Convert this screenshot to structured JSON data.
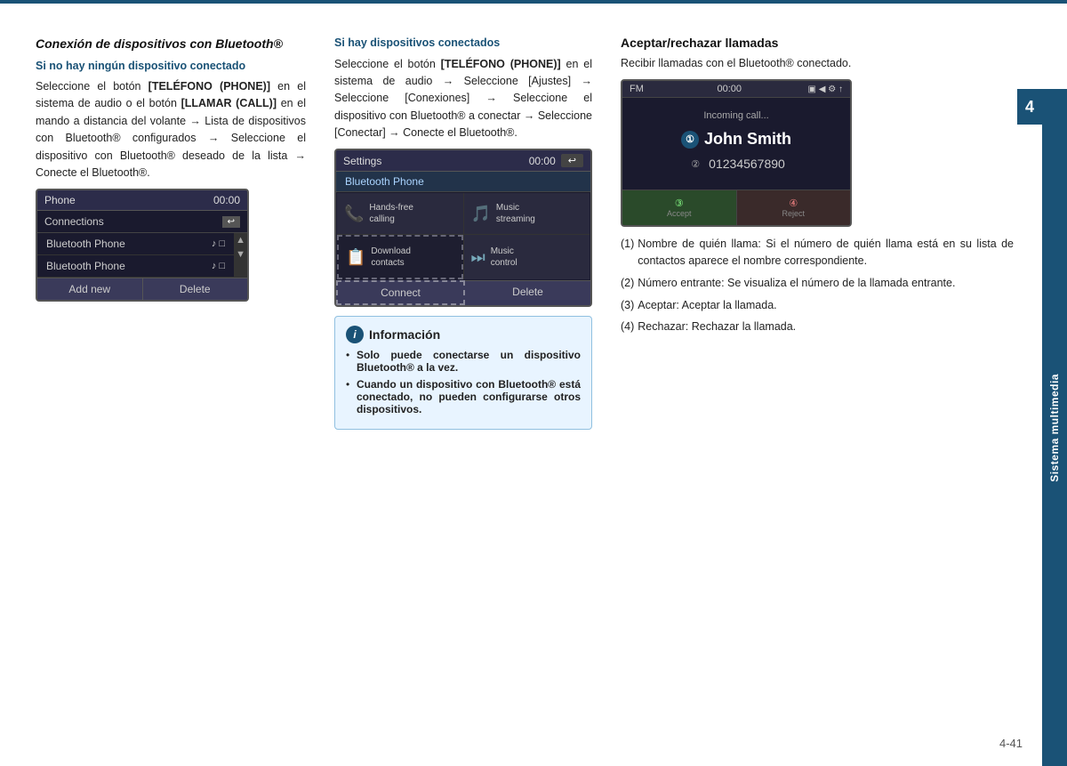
{
  "topLine": {
    "color": "#1a5276"
  },
  "sidebar": {
    "label": "Sistema multimedia",
    "pageNum": "4",
    "color": "#1a5276"
  },
  "pageNumber": "4-41",
  "leftCol": {
    "sectionTitle": "Conexión de dispositivos con Bluetooth®",
    "subtitle1": "Si no hay ningún dispositivo conectado",
    "para1a": "Seleccione el botón ",
    "para1bold": "[TELÉFONO (PHONE)]",
    "para1b": " en el sistema de audio o el botón ",
    "para1bold2": "[LLAMAR (CALL)]",
    "para1c": " en el mando a distancia del volante → Lista de dispositivos con Bluetooth® configurados → Seleccione el dispositivo con Bluetooth® deseado de la lista → Conecte el Bluetooth®.",
    "screen1": {
      "header": {
        "title": "Phone",
        "time": "00:00"
      },
      "row1": {
        "label": "Connections",
        "hasBack": true
      },
      "items": [
        {
          "label": "Bluetooth Phone",
          "icons": "♪ □"
        },
        {
          "label": "Bluetooth Phone",
          "icons": "♪ □"
        }
      ],
      "buttons": [
        {
          "label": "Add new"
        },
        {
          "label": "Delete"
        }
      ]
    }
  },
  "midCol": {
    "subtitle1": "Si hay dispositivos conectados",
    "para1a": "Seleccione el botón ",
    "para1bold": "[TELÉFONO (PHONE)]",
    "para1b": " en el sistema de audio → Seleccione [Ajustes] → Seleccione [Conexiones] → Seleccione el dispositivo con Bluetooth® a conectar → Seleccione [Conectar] → Conecte el Bluetooth®.",
    "screen2": {
      "header": {
        "title": "Settings",
        "time": "00:00"
      },
      "subtitle": "Bluetooth Phone",
      "features": [
        {
          "icon": "📞",
          "label": "Hands-free\ncalling"
        },
        {
          "icon": "🎵",
          "label": "Music\nstreaming"
        },
        {
          "icon": "📋",
          "label": "Download\ncontacts"
        },
        {
          "icon": "⏭",
          "label": "Music\ncontrol"
        }
      ],
      "buttons": [
        {
          "label": "Connect"
        },
        {
          "label": "Delete"
        }
      ]
    },
    "infoBox": {
      "header": "Información",
      "items": [
        "Solo puede conectarse un dispositivo Bluetooth® a la vez.",
        "Cuando un dispositivo con Bluetooth® está conectado, no pueden configurarse otros dispositivos."
      ]
    }
  },
  "rightCol": {
    "sectionTitle": "Aceptar/rechazar llamadas",
    "para1a": "Recibir llamadas con el Bluetooth® conectado.",
    "screen3": {
      "fmBar": {
        "title": "FM",
        "time": "00:00",
        "icons": "□ ◀ ⚙ ↑"
      },
      "incomingLabel": "Incoming call...",
      "callerBadge1": "①",
      "callerName": "John Smith",
      "callerBadge2": "②",
      "callerNumber": "01234567890",
      "btn1": {
        "badgeNum": "③",
        "label": "Accept"
      },
      "btn2": {
        "badgeNum": "④",
        "label": "Reject"
      }
    },
    "notes": [
      {
        "num": "(1)",
        "text": "Nombre de quién llama: Si el número de quién llama está en su lista de contactos aparece el nombre correspondiente."
      },
      {
        "num": "(2)",
        "text": "Número entrante: Se visualiza el número de la llamada entrante."
      },
      {
        "num": "(3)",
        "text": "Aceptar: Aceptar la llamada."
      },
      {
        "num": "(4)",
        "text": "Rechazar: Rechazar la llamada."
      }
    ]
  }
}
